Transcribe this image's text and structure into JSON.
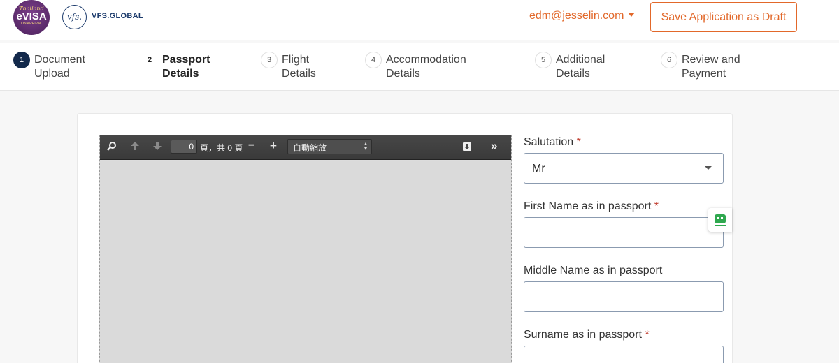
{
  "header": {
    "logo_evisa": {
      "line1": "Thailand",
      "line2": "eVISA",
      "line3": "ON ARRIVAL"
    },
    "vfs_mark": "vfs.",
    "vfs_text": "VFS.GLOBAL",
    "user_email": "edm@jesselin.com",
    "draft_button": "Save Application as Draft",
    "accent_color": "#e2682a"
  },
  "steps": [
    {
      "num": "1",
      "line1": "Document",
      "line2": "Upload",
      "state": "completed"
    },
    {
      "num": "2",
      "line1": "Passport",
      "line2": "Details",
      "state": "current"
    },
    {
      "num": "3",
      "line1": "Flight",
      "line2": "Details",
      "state": "pending"
    },
    {
      "num": "4",
      "line1": "Accommodation",
      "line2": "Details",
      "state": "pending"
    },
    {
      "num": "5",
      "line1": "Additional",
      "line2": "Details",
      "state": "pending"
    },
    {
      "num": "6",
      "line1": "Review and",
      "line2": "Payment",
      "state": "pending"
    }
  ],
  "pdf_viewer": {
    "page_value": "0",
    "page_count_text": "頁，共 0 頁",
    "zoom_label": "自動縮放",
    "icons": [
      "search-icon",
      "prev-page-icon",
      "next-page-icon",
      "zoom-out-icon",
      "zoom-in-icon",
      "download-icon",
      "tools-menu-icon"
    ]
  },
  "form": {
    "salutation": {
      "label": "Salutation",
      "required": "*",
      "value": "Mr"
    },
    "first_name": {
      "label": "First Name as in passport",
      "required": "*",
      "value": ""
    },
    "middle_name": {
      "label": "Middle Name as in passport",
      "value": ""
    },
    "surname": {
      "label": "Surname as in passport",
      "required": "*",
      "value": ""
    }
  }
}
